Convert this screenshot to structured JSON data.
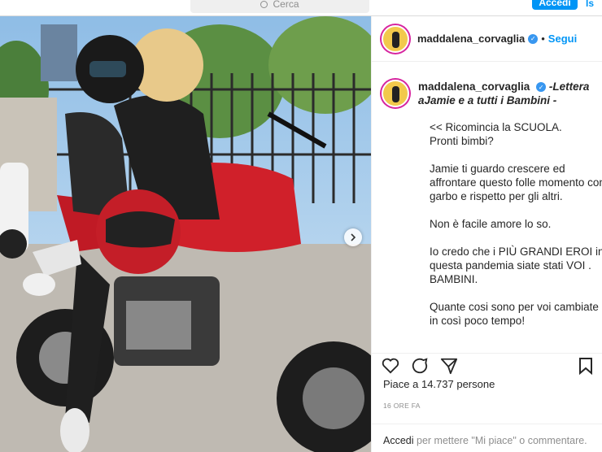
{
  "topbar": {
    "search_placeholder": "Cerca",
    "login_label": "Accedi",
    "signup_label": "Is"
  },
  "post": {
    "username": "maddalena_corvaglia",
    "follow_label": "Segui",
    "dot": "•",
    "caption_lead": "-Lettera aJamie e a tutti i Bambini -",
    "caption_paragraphs": [
      "<< Ricomincia la SCUOLA.\nPronti bimbi?",
      "Jamie ti guardo crescere ed affrontare questo folle momento con garbo e rispetto per gli altri.",
      "Non è facile amore lo so.",
      "Io credo che i PIÙ GRANDI EROI in questa pandemia siate stati VOI . BAMBINI.",
      "Quante cosi sono per voi cambiate in così poco tempo!"
    ],
    "likes": "Piace a 14.737 persone",
    "time_ago": "16 ORE FA",
    "login_prompt_link": "Accedi",
    "login_prompt_rest": " per mettere \"Mi piace\" o commentare."
  },
  "colors": {
    "accent": "#0095f6",
    "moto_red": "#d0202a",
    "text": "#262626",
    "muted": "#8e8e8e"
  },
  "icons": {
    "search": "search-icon",
    "heart": "heart-icon",
    "comment": "comment-icon",
    "share": "share-icon",
    "bookmark": "bookmark-icon",
    "next": "chevron-right-icon",
    "verified": "verified-badge-icon"
  }
}
